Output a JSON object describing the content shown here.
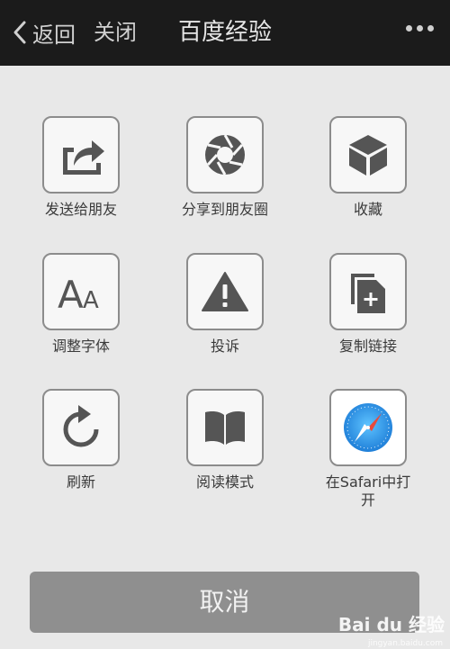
{
  "header": {
    "back_label": "返回",
    "close_label": "关闭",
    "title": "百度经验"
  },
  "share_menu": {
    "items": [
      {
        "label": "发送给朋友",
        "icon": "share-arrow-icon"
      },
      {
        "label": "分享到朋友圈",
        "icon": "moments-shutter-icon"
      },
      {
        "label": "收藏",
        "icon": "cube-icon"
      },
      {
        "label": "调整字体",
        "icon": "font-size-icon"
      },
      {
        "label": "投诉",
        "icon": "warning-icon"
      },
      {
        "label": "复制链接",
        "icon": "copy-link-icon"
      },
      {
        "label": "刷新",
        "icon": "refresh-icon"
      },
      {
        "label": "阅读模式",
        "icon": "book-icon"
      },
      {
        "label": "在Safari中打开",
        "icon": "safari-compass-icon"
      }
    ]
  },
  "cancel_label": "取消",
  "watermark": {
    "logo_text": "Bai du 经验",
    "url": "jingyan.baidu.com"
  },
  "colors": {
    "topbar": "#1b1b1b",
    "background": "#e8e8e8",
    "cancel_button": "#8f8f8f",
    "icon": "#555555",
    "safari_blue": "#2f8fe0"
  }
}
